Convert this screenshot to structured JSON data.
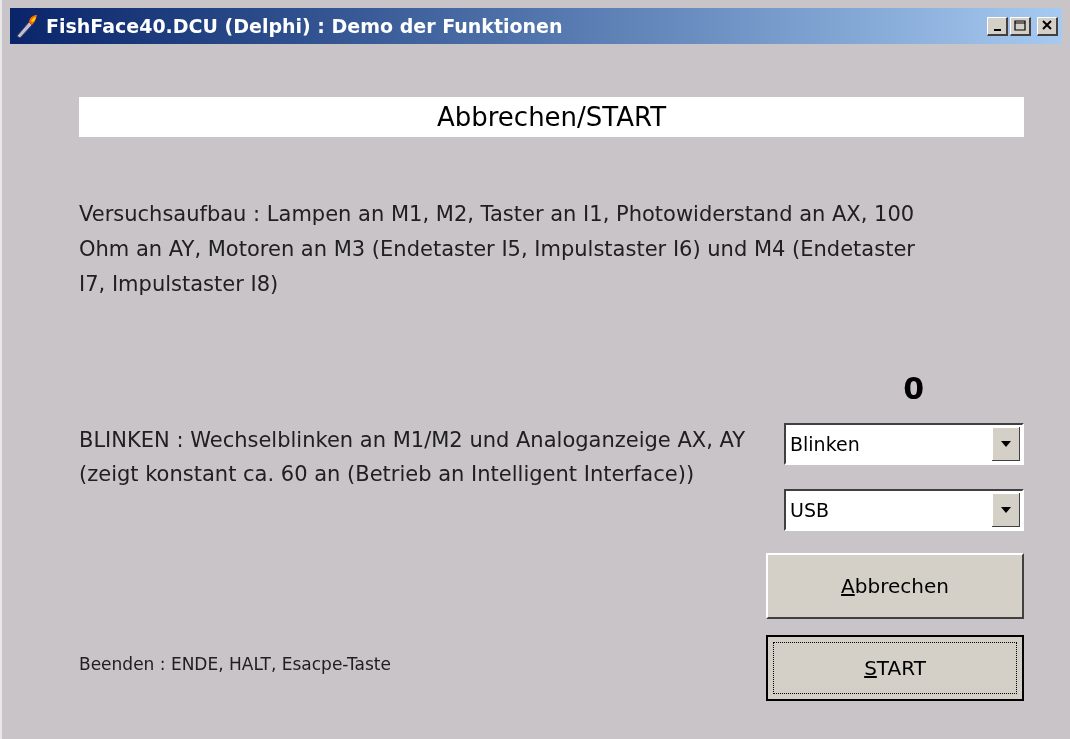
{
  "window": {
    "title": "FishFace40.DCU (Delphi) : Demo der Funktionen"
  },
  "banner": "Abbrechen/START",
  "setup_text": "Versuchsaufbau : Lampen an M1, M2, Taster an I1, Photowiderstand an AX, 100 Ohm an AY, Motoren an M3 (Endetaster I5, Impulstaster I6) und M4 (Endetaster I7, Impulstaster I8)",
  "counter": "0",
  "mode_text": "BLINKEN : Wechselblinken an M1/M2 und Analoganzeige AX, AY (zeigt konstant ca. 60 an (Betrieb an Intelligent Interface))",
  "dropdowns": [
    {
      "value": "Blinken"
    },
    {
      "value": "USB"
    }
  ],
  "buttons": [
    {
      "label": "Abbrechen",
      "default": false
    },
    {
      "label": "START",
      "default": true
    }
  ],
  "exit_text": "Beenden : ENDE, HALT, Esacpe-Taste"
}
